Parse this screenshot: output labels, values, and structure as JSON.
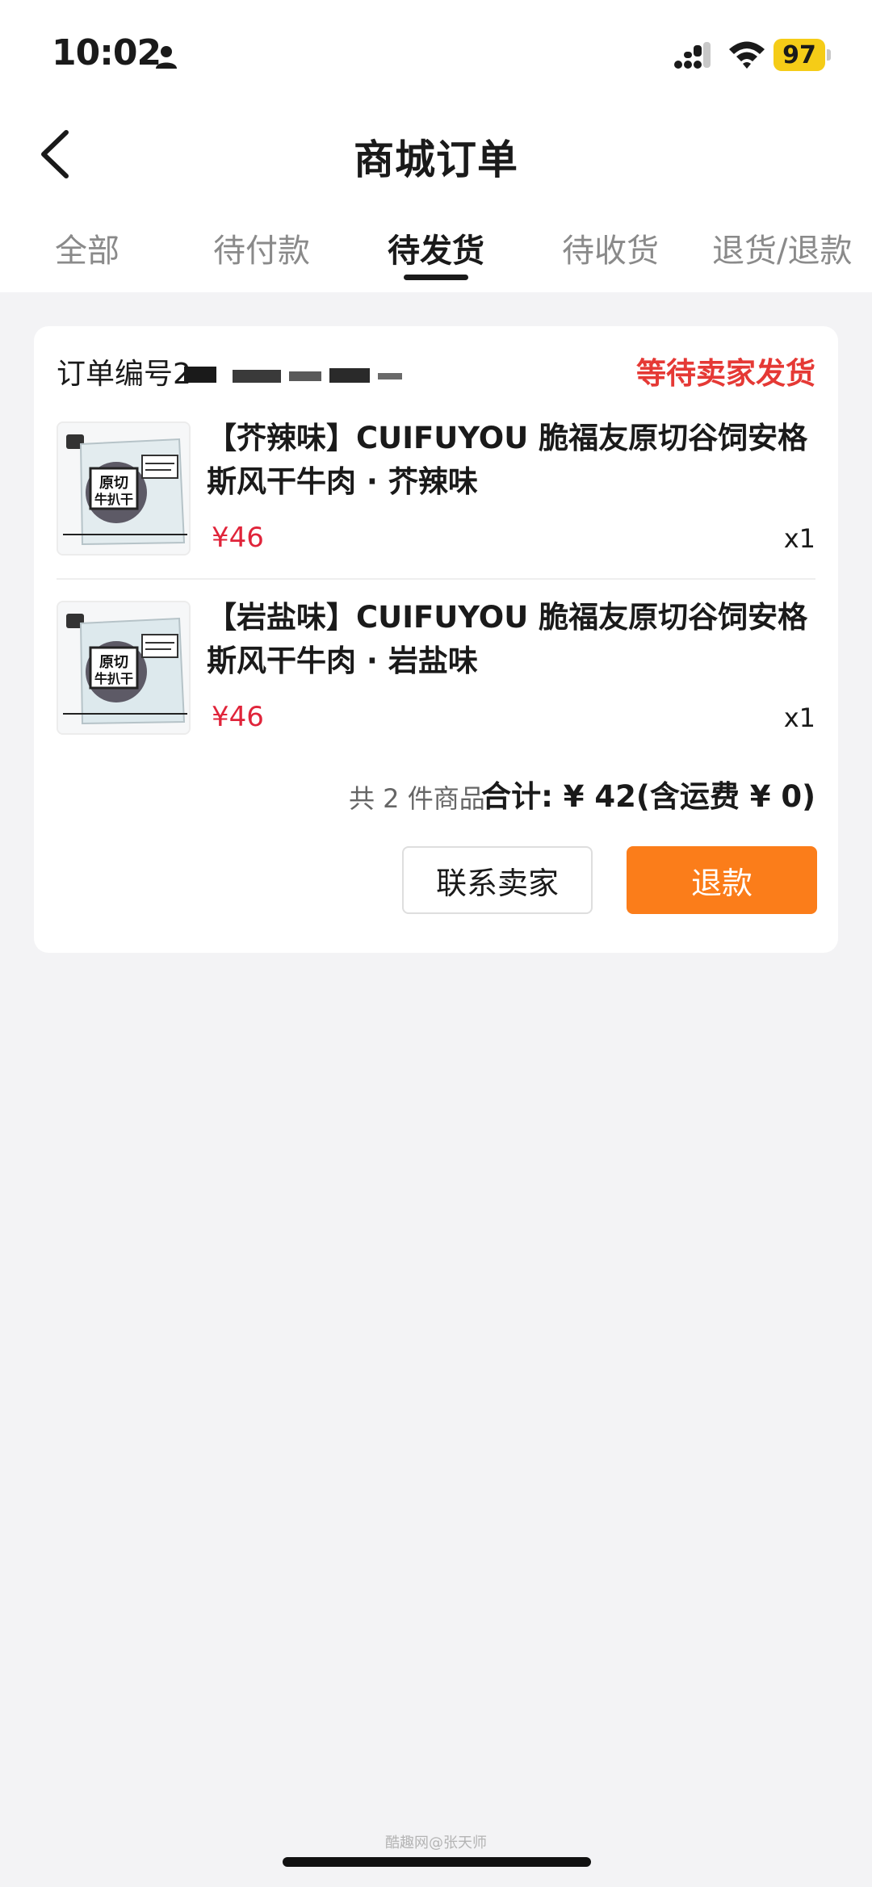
{
  "status_bar": {
    "time": "10:02",
    "battery": "97",
    "icons": [
      "person-icon",
      "signal-icon",
      "wifi-icon",
      "battery-icon"
    ]
  },
  "nav": {
    "title": "商城订单",
    "back_icon": "chevron-left-icon"
  },
  "tabs": [
    {
      "label": "全部",
      "active": false
    },
    {
      "label": "待付款",
      "active": false
    },
    {
      "label": "待发货",
      "active": true
    },
    {
      "label": "待收货",
      "active": false
    },
    {
      "label": "退货/退款",
      "active": false
    }
  ],
  "order": {
    "number_label": "订单编号2",
    "status": "等待卖家发货",
    "items": [
      {
        "title": "【芥辣味】CUIFUYOU 脆福友原切谷饲安格斯风干牛肉 · 芥辣味",
        "price": "¥46",
        "qty": "x1",
        "thumb_text": "原切牛扒干"
      },
      {
        "title": "【岩盐味】CUIFUYOU 脆福友原切谷饲安格斯风干牛肉 · 岩盐味",
        "price": "¥46",
        "qty": "x1",
        "thumb_text": "原切牛扒干"
      }
    ],
    "summary_count": "共 2 件商品",
    "summary_total": "合计: ¥ 42(含运费 ¥ 0)",
    "actions": {
      "contact": "联系卖家",
      "refund": "退款"
    }
  },
  "watermark": "酷趣网@张天师",
  "colors": {
    "status_red": "#e53935",
    "price_red": "#e0243a",
    "refund_orange": "#fb7d1a",
    "battery_yellow": "#f5cc17"
  }
}
